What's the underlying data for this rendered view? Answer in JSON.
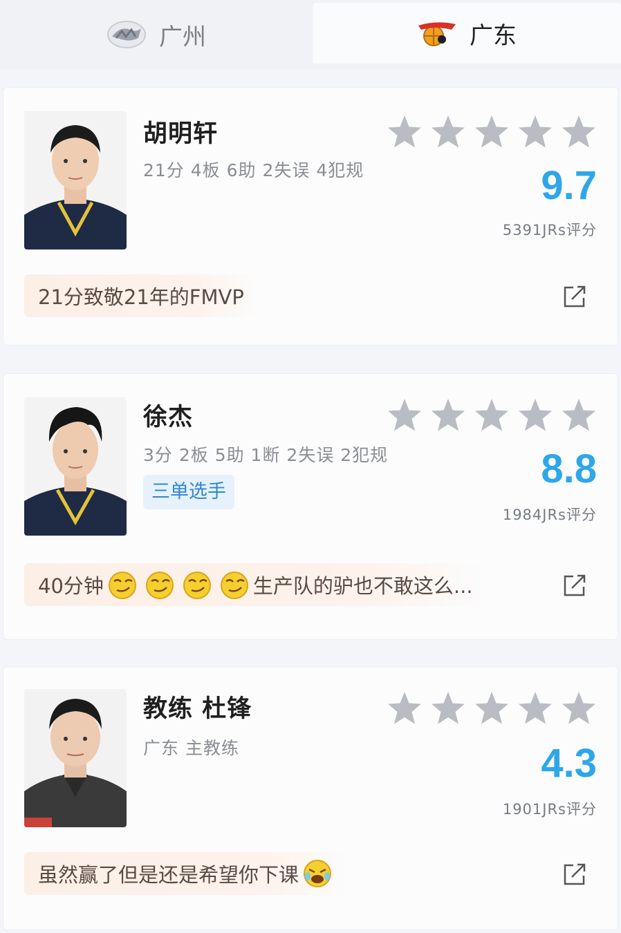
{
  "tabs": [
    {
      "label": "广州",
      "logo": "guangzhou-team-logo",
      "active": false
    },
    {
      "label": "广东",
      "logo": "guangdong-team-logo",
      "active": true
    }
  ],
  "cards": [
    {
      "name": "胡明轩",
      "stats": "21分 4板 6助 2失误 4犯规",
      "tag": "",
      "rating_stars": 0,
      "score": "9.7",
      "jrs": "5391JRs评分",
      "comment": "21分致敬21年的FMVP",
      "avatar": "player-photo"
    },
    {
      "name": "徐杰",
      "stats": "3分 2板 5助 1断 2失误 2犯规",
      "tag": "三单选手",
      "rating_stars": 0,
      "score": "8.8",
      "jrs": "1984JRs评分",
      "comment_prefix": "40分钟",
      "comment_emoji_count": 4,
      "comment_suffix": "生产队的驴也不敢这么...",
      "avatar": "player-photo"
    },
    {
      "name": "教练 杜锋",
      "stats": "广东 主教练",
      "tag": "",
      "rating_stars": 0,
      "score": "4.3",
      "jrs": "1901JRs评分",
      "comment": "虽然赢了但是还是希望你下课",
      "comment_emoji": "laughing-crying-emoji",
      "avatar": "coach-photo"
    }
  ],
  "icons": {
    "star": "star-icon",
    "share": "share-icon",
    "emoji": "smirk-emoji"
  },
  "colors": {
    "score": "#2ea7e8",
    "star": "#b9bcc2",
    "tag_bg": "#e6f1fb",
    "tag_text": "#2f86d4",
    "comment_bg": "#fbefe6"
  }
}
